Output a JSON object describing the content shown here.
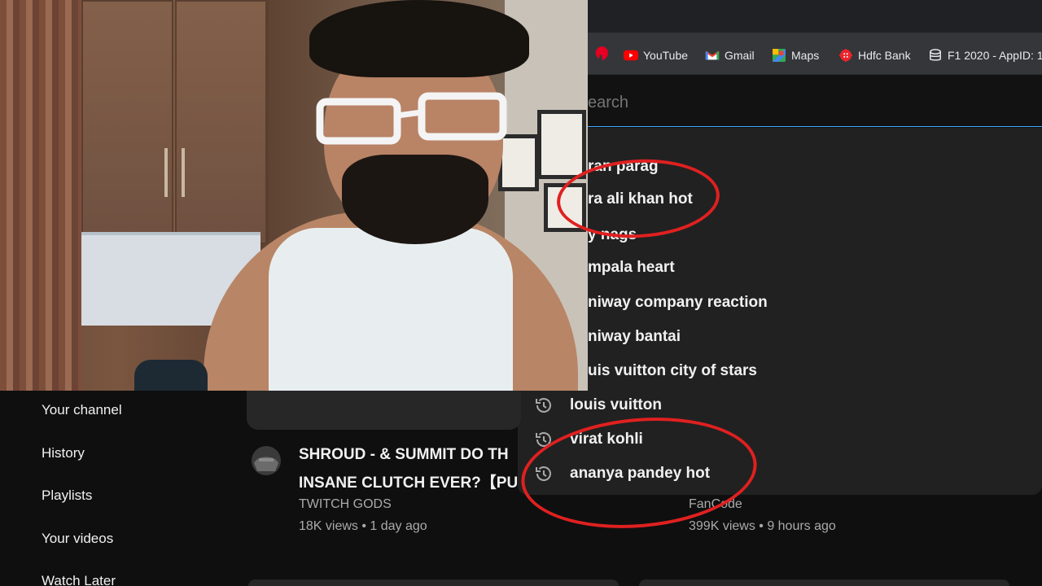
{
  "bookmarks": [
    {
      "label": "YouTube",
      "icon": "youtube-icon"
    },
    {
      "label": "Gmail",
      "icon": "gmail-icon"
    },
    {
      "label": "Maps",
      "icon": "maps-icon"
    },
    {
      "label": "Hdfc Bank",
      "icon": "hdfc-icon"
    },
    {
      "label": "F1 2020 - AppID: 1",
      "icon": "database-icon"
    }
  ],
  "search": {
    "placeholder": "earch",
    "suggestions": [
      "ran parag",
      "ra ali khan hot",
      "y nags",
      "mpala heart",
      "niway company reaction",
      "niway bantai",
      "uis vuitton city of stars",
      "louis vuitton",
      "virat kohli",
      "ananya pandey hot"
    ]
  },
  "sidebar": {
    "items": [
      "Your channel",
      "History",
      "Playlists",
      "Your videos",
      "Watch Later"
    ]
  },
  "video1": {
    "title_line1": "SHROUD - & SUMMIT DO TH",
    "title_line2": "INSANE CLUTCH EVER?【PU",
    "channel": "TWITCH GODS",
    "meta": "18K views • 1 day ago"
  },
  "video2": {
    "channel": "FanCode",
    "meta": "399K views • 9 hours ago"
  },
  "colors": {
    "annotation": "#e02020",
    "background": "#0f0f0f",
    "panel": "#212121",
    "search_focus": "#3ea6ff"
  }
}
